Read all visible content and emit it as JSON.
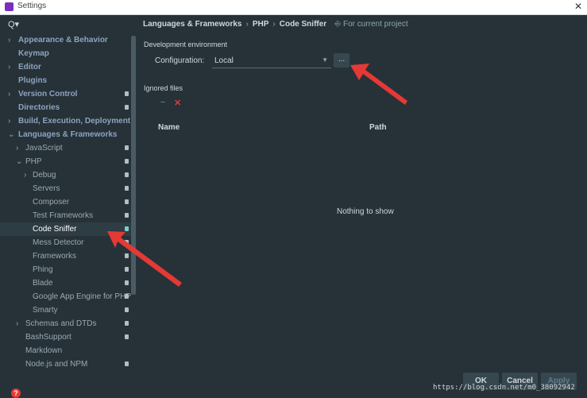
{
  "window": {
    "title": "Settings",
    "close": "✕"
  },
  "sidebar": {
    "search_icon": "Q▾",
    "items": [
      {
        "label": "Appearance & Behavior",
        "expander": "›",
        "level": 0,
        "bold": true
      },
      {
        "label": "Keymap",
        "expander": "",
        "level": 0,
        "bold": true
      },
      {
        "label": "Editor",
        "expander": "›",
        "level": 0,
        "bold": true
      },
      {
        "label": "Plugins",
        "expander": "",
        "level": 0,
        "bold": true
      },
      {
        "label": "Version Control",
        "expander": "›",
        "level": 0,
        "bold": true,
        "proj": true
      },
      {
        "label": "Directories",
        "expander": "",
        "level": 0,
        "bold": true,
        "proj": true
      },
      {
        "label": "Build, Execution, Deployment",
        "expander": "›",
        "level": 0,
        "bold": true
      },
      {
        "label": "Languages & Frameworks",
        "expander": "⌄",
        "level": 0,
        "bold": true
      },
      {
        "label": "JavaScript",
        "expander": "›",
        "level": 1,
        "proj": true
      },
      {
        "label": "PHP",
        "expander": "⌄",
        "level": 1,
        "proj": true
      },
      {
        "label": "Debug",
        "expander": "›",
        "level": 2,
        "proj": true
      },
      {
        "label": "Servers",
        "expander": "",
        "level": 2,
        "proj": true
      },
      {
        "label": "Composer",
        "expander": "",
        "level": 2,
        "proj": true
      },
      {
        "label": "Test Frameworks",
        "expander": "",
        "level": 2,
        "proj": true
      },
      {
        "label": "Code Sniffer",
        "expander": "",
        "level": 2,
        "proj": true,
        "selected": true
      },
      {
        "label": "Mess Detector",
        "expander": "",
        "level": 2,
        "proj": true
      },
      {
        "label": "Frameworks",
        "expander": "",
        "level": 2,
        "proj": true
      },
      {
        "label": "Phing",
        "expander": "",
        "level": 2,
        "proj": true
      },
      {
        "label": "Blade",
        "expander": "",
        "level": 2,
        "proj": true
      },
      {
        "label": "Google App Engine for PHP",
        "expander": "",
        "level": 2,
        "proj": true
      },
      {
        "label": "Smarty",
        "expander": "",
        "level": 2,
        "proj": true
      },
      {
        "label": "Schemas and DTDs",
        "expander": "›",
        "level": 1,
        "proj": true
      },
      {
        "label": "BashSupport",
        "expander": "",
        "level": 1,
        "proj": true
      },
      {
        "label": "Markdown",
        "expander": "",
        "level": 1
      },
      {
        "label": "Node.js and NPM",
        "expander": "",
        "level": 1,
        "proj": true
      }
    ]
  },
  "breadcrumb": {
    "part1": "Languages & Frameworks",
    "sep1": "›",
    "part2": "PHP",
    "sep2": "›",
    "part3": "Code Sniffer",
    "project_scope": "⎆ For current project"
  },
  "dev_env": {
    "heading": "Development environment",
    "config_label": "Configuration:",
    "config_value": "Local",
    "dropdown_icon": "▼",
    "browse_label": "..."
  },
  "ignored": {
    "heading": "Ignored files",
    "remove_icon": "−",
    "delete_icon": "✕",
    "col_name": "Name",
    "col_path": "Path",
    "empty_text": "Nothing to show"
  },
  "buttons": {
    "ok": "OK",
    "cancel": "Cancel",
    "apply": "Apply"
  },
  "help_icon": "?",
  "watermark": "https://blog.csdn.net/m0_38092942",
  "colors": {
    "background": "#263238",
    "arrow": "#e53935",
    "selected": "#2e3c43"
  }
}
